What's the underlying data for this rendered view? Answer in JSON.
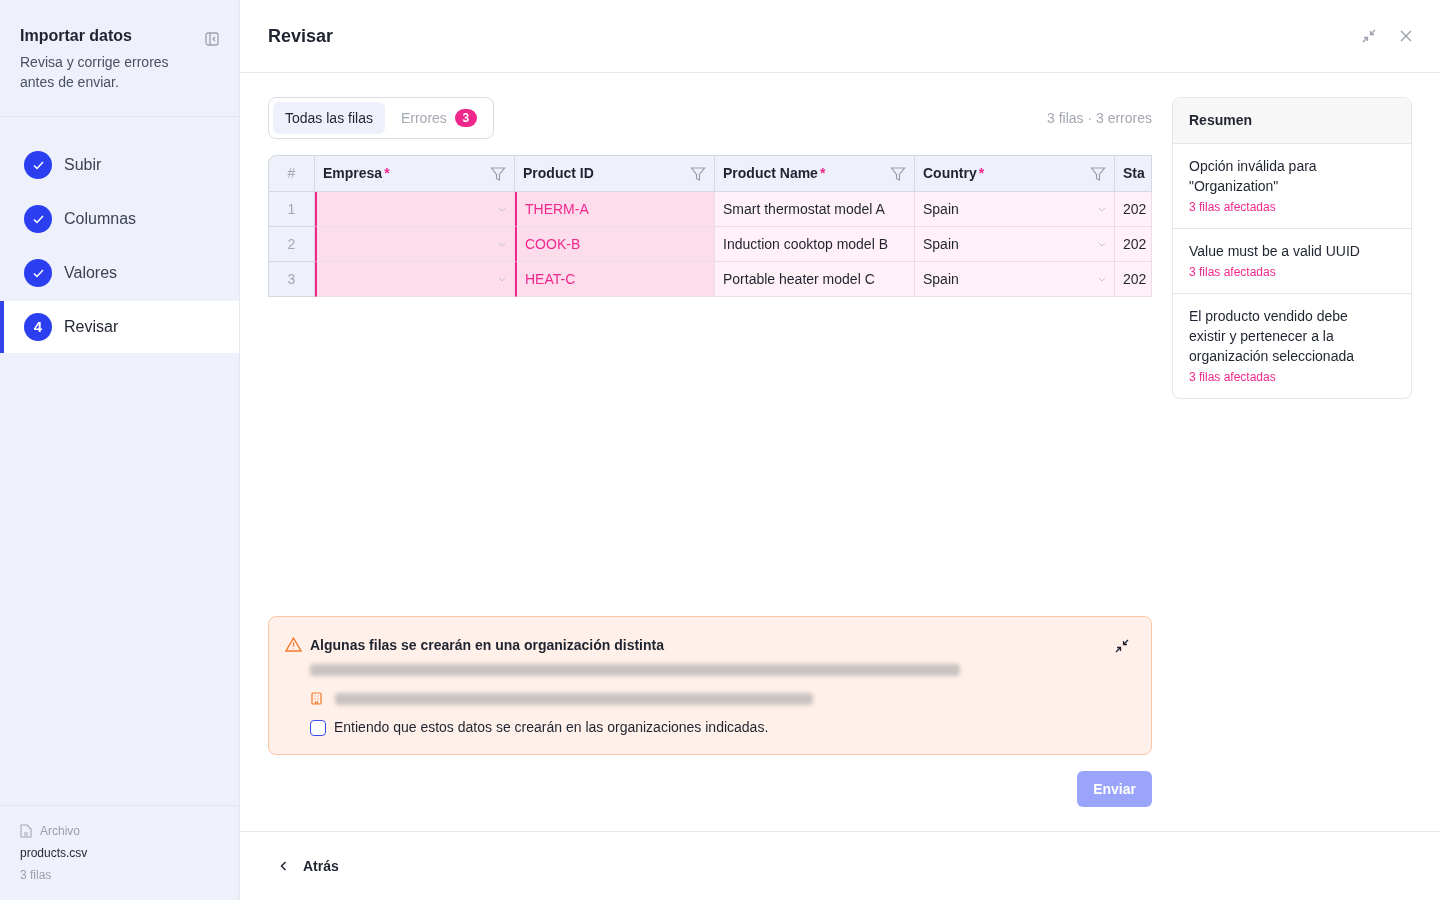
{
  "sidebar": {
    "title": "Importar datos",
    "subtitle": "Revisa y corrige errores antes de enviar.",
    "steps": [
      {
        "label": "Subir",
        "done": true,
        "selected": false
      },
      {
        "label": "Columnas",
        "done": true,
        "selected": false
      },
      {
        "label": "Valores",
        "done": true,
        "selected": false
      },
      {
        "label": "Revisar",
        "done": false,
        "selected": true,
        "number": "4"
      }
    ],
    "file": {
      "label": "Archivo",
      "name": "products.csv",
      "rows": "3 filas"
    }
  },
  "header": {
    "title": "Revisar"
  },
  "tabs": [
    {
      "label": "Todas las filas",
      "selected": true
    },
    {
      "label": "Errores",
      "selected": false,
      "count": "3"
    }
  ],
  "counts": "3 filas · 3 errores",
  "table": {
    "index_header": "#",
    "columns": [
      {
        "label": "Empresa",
        "required_mark": "*",
        "filter": true
      },
      {
        "label": "Product ID",
        "filter": true
      },
      {
        "label": "Product Name",
        "required_mark": "*",
        "filter": true
      },
      {
        "label": "Country",
        "required_mark": "*",
        "filter": true
      },
      {
        "label": "Sta",
        "filter": false
      }
    ],
    "rows": [
      {
        "index": "1",
        "cells": [
          {
            "kind": "select",
            "text": "",
            "error": true
          },
          {
            "kind": "text",
            "text": "THERM-A",
            "error": true
          },
          {
            "kind": "text",
            "text": "Smart thermostat model A",
            "error": false
          },
          {
            "kind": "select",
            "text": "Spain",
            "error": false
          },
          {
            "kind": "text",
            "text": "202",
            "error": false
          }
        ]
      },
      {
        "index": "2",
        "cells": [
          {
            "kind": "select",
            "text": "",
            "error": true
          },
          {
            "kind": "text",
            "text": "COOK-B",
            "error": true
          },
          {
            "kind": "text",
            "text": "Induction cooktop model B",
            "error": false
          },
          {
            "kind": "select",
            "text": "Spain",
            "error": false
          },
          {
            "kind": "text",
            "text": "202",
            "error": false
          }
        ]
      },
      {
        "index": "3",
        "cells": [
          {
            "kind": "select",
            "text": "",
            "error": true
          },
          {
            "kind": "text",
            "text": "HEAT-C",
            "error": true
          },
          {
            "kind": "text",
            "text": "Portable heater model C",
            "error": false
          },
          {
            "kind": "select",
            "text": "Spain",
            "error": false
          },
          {
            "kind": "text",
            "text": "202",
            "error": false
          }
        ]
      }
    ]
  },
  "summary": {
    "title": "Resumen",
    "items": [
      {
        "message": "Opción inválida para \"Organization\"",
        "affected": "3 filas afectadas"
      },
      {
        "message": "Value must be a valid UUID",
        "affected": "3 filas afectadas"
      },
      {
        "message": "El producto vendido debe existir y pertenecer a la organización seleccionada",
        "affected": "3 filas afectadas"
      }
    ]
  },
  "alert": {
    "title": "Algunas filas se crearán en una organización distinta",
    "checkbox": {
      "label": "Entiendo que estos datos se crearán en las organizaciones indicadas.",
      "checked": false
    }
  },
  "submit": {
    "label": "Enviar",
    "disabled": true
  },
  "back": {
    "label": "Atrás"
  }
}
